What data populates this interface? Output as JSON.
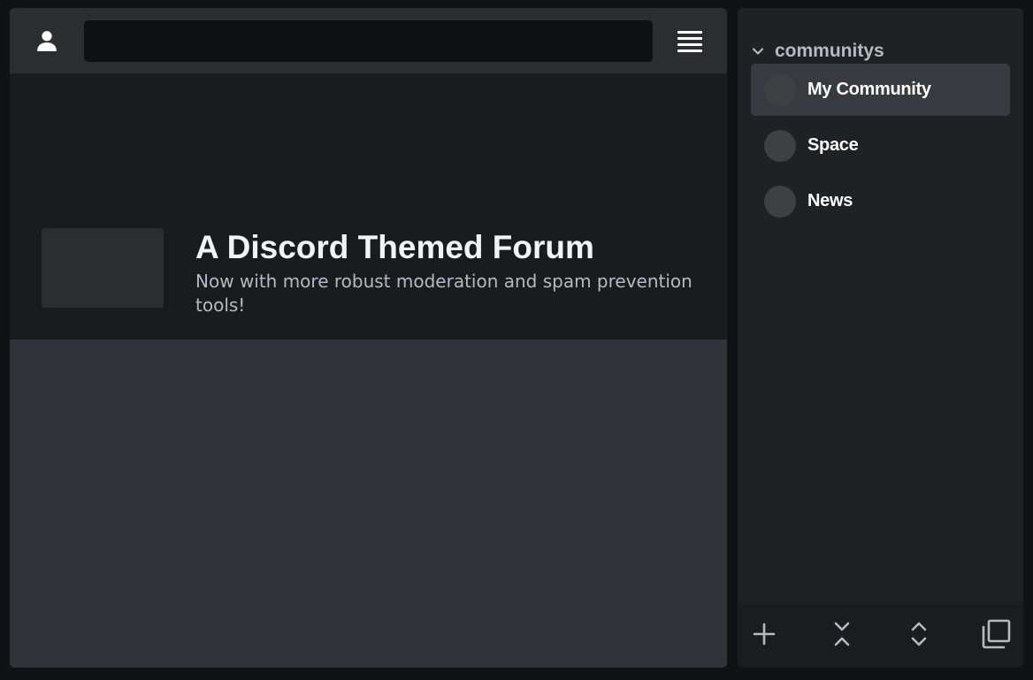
{
  "header": {
    "search": {
      "value": "",
      "placeholder": ""
    },
    "icons": {
      "user": "user-icon",
      "menu": "menu-icon"
    }
  },
  "hero": {
    "title": "A Discord Themed Forum",
    "subtitle": "Now with more robust moderation and spam prevention tools!"
  },
  "sidebar": {
    "section_label": "communitys",
    "items": [
      {
        "label": "My Community",
        "active": true
      },
      {
        "label": "Space",
        "active": false
      },
      {
        "label": "News",
        "active": false
      }
    ],
    "footer_icons": [
      "plus-icon",
      "collapse-icon",
      "expand-icon",
      "popout-icon"
    ]
  },
  "colors": {
    "page_background": "#111214",
    "main_panel": "#313338",
    "topbar": "#2b2d31",
    "search_field": "#0f1013",
    "hero_background": "#1a1b1e",
    "sidebar": "#202125",
    "sidebar_active_item": "#393a3f",
    "avatar_placeholder": "#3f4044",
    "text_primary": "#f2f3f5",
    "text_muted": "#b5bac1"
  }
}
